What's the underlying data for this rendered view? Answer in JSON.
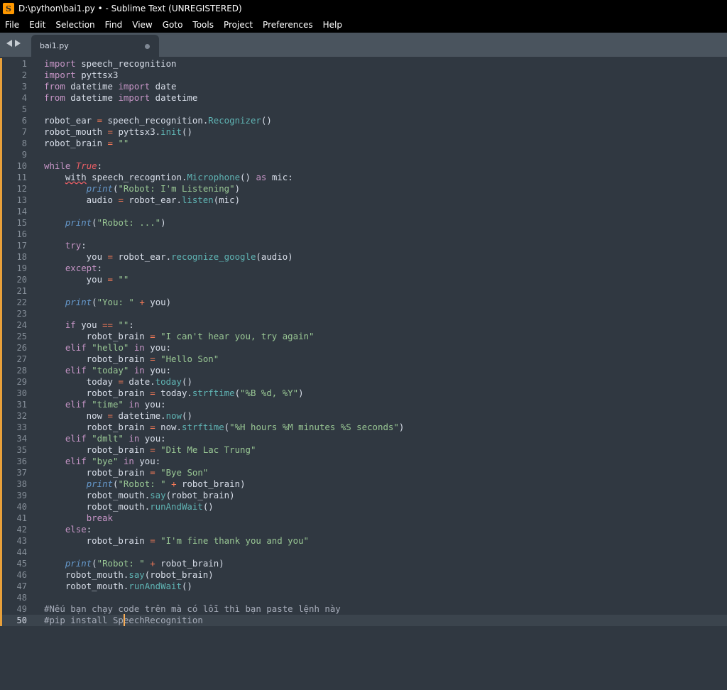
{
  "window": {
    "title": "D:\\python\\bai1.py • - Sublime Text (UNREGISTERED)"
  },
  "menu": [
    "File",
    "Edit",
    "Selection",
    "Find",
    "View",
    "Goto",
    "Tools",
    "Project",
    "Preferences",
    "Help"
  ],
  "tab": {
    "name": "bai1.py",
    "modified": true
  },
  "editor": {
    "current_line": 50,
    "caret": {
      "line": 50,
      "col": 15
    },
    "lines": [
      [
        [
          "kw",
          "import"
        ],
        [
          "t",
          " speech_recognition"
        ]
      ],
      [
        [
          "kw",
          "import"
        ],
        [
          "t",
          " pyttsx3"
        ]
      ],
      [
        [
          "kw",
          "from"
        ],
        [
          "t",
          " datetime "
        ],
        [
          "kw",
          "import"
        ],
        [
          "t",
          " date"
        ]
      ],
      [
        [
          "kw",
          "from"
        ],
        [
          "t",
          " datetime "
        ],
        [
          "kw",
          "import"
        ],
        [
          "t",
          " datetime"
        ]
      ],
      [],
      [
        [
          "t",
          "robot_ear "
        ],
        [
          "op",
          "="
        ],
        [
          "t",
          " speech_recognition."
        ],
        [
          "fn",
          "Recognizer"
        ],
        [
          "t",
          "()"
        ]
      ],
      [
        [
          "t",
          "robot_mouth "
        ],
        [
          "op",
          "="
        ],
        [
          "t",
          " pyttsx3."
        ],
        [
          "fn",
          "init"
        ],
        [
          "t",
          "()"
        ]
      ],
      [
        [
          "t",
          "robot_brain "
        ],
        [
          "op",
          "="
        ],
        [
          "t",
          " "
        ],
        [
          "str",
          "\"\""
        ]
      ],
      [],
      [
        [
          "kw",
          "while"
        ],
        [
          "t",
          " "
        ],
        [
          "const",
          "True"
        ],
        [
          "t",
          ":"
        ]
      ],
      [
        [
          "t",
          "    "
        ],
        [
          "err",
          "with"
        ],
        [
          "t",
          " speech_recogntion."
        ],
        [
          "fn",
          "Microphone"
        ],
        [
          "t",
          "() "
        ],
        [
          "kw",
          "as"
        ],
        [
          "t",
          " mic:"
        ]
      ],
      [
        [
          "t",
          "        "
        ],
        [
          "builtin",
          "print"
        ],
        [
          "t",
          "("
        ],
        [
          "str",
          "\"Robot: I'm Listening\""
        ],
        [
          "t",
          ")"
        ]
      ],
      [
        [
          "t",
          "        audio "
        ],
        [
          "op",
          "="
        ],
        [
          "t",
          " robot_ear."
        ],
        [
          "fn",
          "listen"
        ],
        [
          "t",
          "(mic)"
        ]
      ],
      [],
      [
        [
          "t",
          "    "
        ],
        [
          "builtin",
          "print"
        ],
        [
          "t",
          "("
        ],
        [
          "str",
          "\"Robot: ...\""
        ],
        [
          "t",
          ")"
        ]
      ],
      [],
      [
        [
          "t",
          "    "
        ],
        [
          "kw",
          "try"
        ],
        [
          "t",
          ":"
        ]
      ],
      [
        [
          "t",
          "        you "
        ],
        [
          "op",
          "="
        ],
        [
          "t",
          " robot_ear."
        ],
        [
          "fn",
          "recognize_google"
        ],
        [
          "t",
          "(audio)"
        ]
      ],
      [
        [
          "t",
          "    "
        ],
        [
          "kw",
          "except"
        ],
        [
          "t",
          ":"
        ]
      ],
      [
        [
          "t",
          "        you "
        ],
        [
          "op",
          "="
        ],
        [
          "t",
          " "
        ],
        [
          "str",
          "\"\""
        ]
      ],
      [],
      [
        [
          "t",
          "    "
        ],
        [
          "builtin",
          "print"
        ],
        [
          "t",
          "("
        ],
        [
          "str",
          "\"You: \""
        ],
        [
          "t",
          " "
        ],
        [
          "op",
          "+"
        ],
        [
          "t",
          " you)"
        ]
      ],
      [],
      [
        [
          "t",
          "    "
        ],
        [
          "kw",
          "if"
        ],
        [
          "t",
          " you "
        ],
        [
          "op",
          "=="
        ],
        [
          "t",
          " "
        ],
        [
          "str",
          "\"\""
        ],
        [
          "t",
          ":"
        ]
      ],
      [
        [
          "t",
          "        robot_brain "
        ],
        [
          "op",
          "="
        ],
        [
          "t",
          " "
        ],
        [
          "str",
          "\"I can't hear you, try again\""
        ]
      ],
      [
        [
          "t",
          "    "
        ],
        [
          "kw",
          "elif"
        ],
        [
          "t",
          " "
        ],
        [
          "str",
          "\"hello\""
        ],
        [
          "t",
          " "
        ],
        [
          "kw",
          "in"
        ],
        [
          "t",
          " you:"
        ]
      ],
      [
        [
          "t",
          "        robot_brain "
        ],
        [
          "op",
          "="
        ],
        [
          "t",
          " "
        ],
        [
          "str",
          "\"Hello Son\""
        ]
      ],
      [
        [
          "t",
          "    "
        ],
        [
          "kw",
          "elif"
        ],
        [
          "t",
          " "
        ],
        [
          "str",
          "\"today\""
        ],
        [
          "t",
          " "
        ],
        [
          "kw",
          "in"
        ],
        [
          "t",
          " you:"
        ]
      ],
      [
        [
          "t",
          "        today "
        ],
        [
          "op",
          "="
        ],
        [
          "t",
          " date."
        ],
        [
          "fn",
          "today"
        ],
        [
          "t",
          "()"
        ]
      ],
      [
        [
          "t",
          "        robot_brain "
        ],
        [
          "op",
          "="
        ],
        [
          "t",
          " today."
        ],
        [
          "fn",
          "strftime"
        ],
        [
          "t",
          "("
        ],
        [
          "str",
          "\"%B %d, %Y\""
        ],
        [
          "t",
          ")"
        ]
      ],
      [
        [
          "t",
          "    "
        ],
        [
          "kw",
          "elif"
        ],
        [
          "t",
          " "
        ],
        [
          "str",
          "\"time\""
        ],
        [
          "t",
          " "
        ],
        [
          "kw",
          "in"
        ],
        [
          "t",
          " you:"
        ]
      ],
      [
        [
          "t",
          "        now "
        ],
        [
          "op",
          "="
        ],
        [
          "t",
          " datetime."
        ],
        [
          "fn",
          "now"
        ],
        [
          "t",
          "()"
        ]
      ],
      [
        [
          "t",
          "        robot_brain "
        ],
        [
          "op",
          "="
        ],
        [
          "t",
          " now."
        ],
        [
          "fn",
          "strftime"
        ],
        [
          "t",
          "("
        ],
        [
          "str",
          "\"%H hours %M minutes %S seconds\""
        ],
        [
          "t",
          ")"
        ]
      ],
      [
        [
          "t",
          "    "
        ],
        [
          "kw",
          "elif"
        ],
        [
          "t",
          " "
        ],
        [
          "str",
          "\"dmlt\""
        ],
        [
          "t",
          " "
        ],
        [
          "kw",
          "in"
        ],
        [
          "t",
          " you:"
        ]
      ],
      [
        [
          "t",
          "        robot_brain "
        ],
        [
          "op",
          "="
        ],
        [
          "t",
          " "
        ],
        [
          "str",
          "\"Dit Me Lac Trung\""
        ]
      ],
      [
        [
          "t",
          "    "
        ],
        [
          "kw",
          "elif"
        ],
        [
          "t",
          " "
        ],
        [
          "str",
          "\"bye\""
        ],
        [
          "t",
          " "
        ],
        [
          "kw",
          "in"
        ],
        [
          "t",
          " you:"
        ]
      ],
      [
        [
          "t",
          "        robot_brain "
        ],
        [
          "op",
          "="
        ],
        [
          "t",
          " "
        ],
        [
          "str",
          "\"Bye Son\""
        ]
      ],
      [
        [
          "t",
          "        "
        ],
        [
          "builtin",
          "print"
        ],
        [
          "t",
          "("
        ],
        [
          "str",
          "\"Robot: \""
        ],
        [
          "t",
          " "
        ],
        [
          "op",
          "+"
        ],
        [
          "t",
          " robot_brain)"
        ]
      ],
      [
        [
          "t",
          "        robot_mouth."
        ],
        [
          "fn",
          "say"
        ],
        [
          "t",
          "(robot_brain)"
        ]
      ],
      [
        [
          "t",
          "        robot_mouth."
        ],
        [
          "fn",
          "runAndWait"
        ],
        [
          "t",
          "()"
        ]
      ],
      [
        [
          "t",
          "        "
        ],
        [
          "kw",
          "break"
        ]
      ],
      [
        [
          "t",
          "    "
        ],
        [
          "kw",
          "else"
        ],
        [
          "t",
          ":"
        ]
      ],
      [
        [
          "t",
          "        robot_brain "
        ],
        [
          "op",
          "="
        ],
        [
          "t",
          " "
        ],
        [
          "str",
          "\"I'm fine thank you and you\""
        ]
      ],
      [],
      [
        [
          "t",
          "    "
        ],
        [
          "builtin",
          "print"
        ],
        [
          "t",
          "("
        ],
        [
          "str",
          "\"Robot: \""
        ],
        [
          "t",
          " "
        ],
        [
          "op",
          "+"
        ],
        [
          "t",
          " robot_brain)"
        ]
      ],
      [
        [
          "t",
          "    robot_mouth."
        ],
        [
          "fn",
          "say"
        ],
        [
          "t",
          "(robot_brain)"
        ]
      ],
      [
        [
          "t",
          "    robot_mouth."
        ],
        [
          "fn",
          "runAndWait"
        ],
        [
          "t",
          "()"
        ]
      ],
      [],
      [
        [
          "cmt",
          "#Nếu bạn chạy code trên mà có lỗi thì bạn paste lệnh này"
        ]
      ],
      [
        [
          "cmt",
          "#pip install SpeechRecognition"
        ]
      ]
    ]
  },
  "colors": {
    "background": "#303841",
    "keyword": "#c695c6",
    "function": "#5fb4b4",
    "string": "#99c794",
    "constant": "#ec5f66",
    "builtin": "#6699cc",
    "operator": "#f97b58",
    "comment": "#a6acb9",
    "modified_marker": "#e8a03a"
  }
}
